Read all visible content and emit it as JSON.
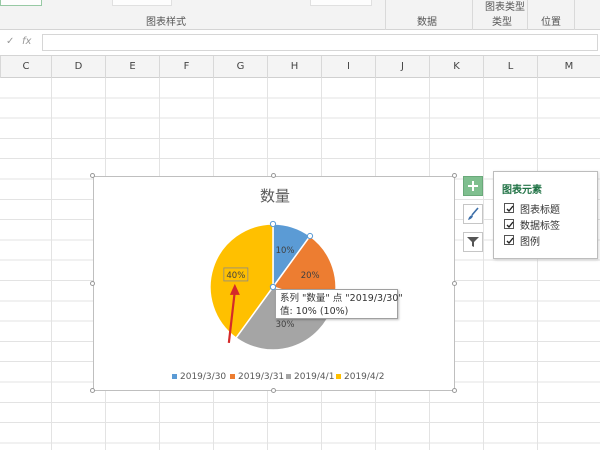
{
  "ribbon": {
    "groups": [
      {
        "label": "图表样式"
      },
      {
        "label": "数据"
      },
      {
        "label": "图表类型"
      },
      {
        "label": "类型"
      },
      {
        "label": "位置"
      }
    ]
  },
  "formula_bar": {
    "fx_label": "fx",
    "value": ""
  },
  "columns": [
    "C",
    "D",
    "E",
    "F",
    "G",
    "H",
    "I",
    "J",
    "K",
    "L",
    "M"
  ],
  "chart_data": {
    "type": "pie",
    "title": "数量",
    "categories": [
      "2019/3/30",
      "2019/3/31",
      "2019/4/1",
      "2019/4/2"
    ],
    "values": [
      10,
      20,
      30,
      40
    ],
    "data_labels": [
      "10%",
      "20%",
      "30%",
      "40%"
    ],
    "colors": [
      "#5b9bd5",
      "#ed7d31",
      "#a5a5a5",
      "#ffc000"
    ],
    "legend_position": "bottom"
  },
  "tooltip": {
    "line1": "系列 \"数量\" 点 \"2019/3/30\"",
    "line2": "值: 10% (10%)"
  },
  "chart_elements_panel": {
    "title": "图表元素",
    "items": [
      {
        "label": "图表标题",
        "checked": true
      },
      {
        "label": "数据标签",
        "checked": true
      },
      {
        "label": "图例",
        "checked": true
      }
    ]
  },
  "side_buttons": [
    {
      "icon": "plus-icon"
    },
    {
      "icon": "brush-icon"
    },
    {
      "icon": "filter-icon"
    }
  ]
}
